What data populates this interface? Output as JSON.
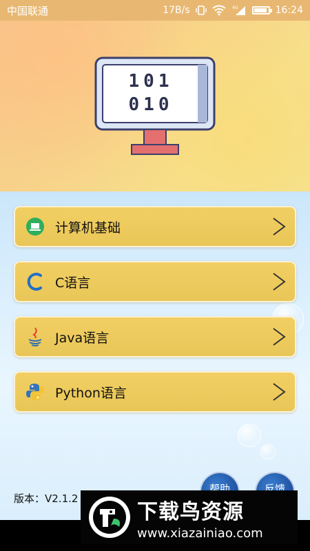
{
  "status_bar": {
    "carrier": "中国联通",
    "speed": "17B/s",
    "network": "4G",
    "time": "16:24"
  },
  "banner": {
    "screen_line1": "101",
    "screen_line2": "010"
  },
  "menu": [
    {
      "label": "计算机基础",
      "icon": "laptop-icon"
    },
    {
      "label": "C语言",
      "icon": "c-letter-icon"
    },
    {
      "label": "Java语言",
      "icon": "java-icon"
    },
    {
      "label": "Python语言",
      "icon": "python-icon"
    }
  ],
  "footer": {
    "version": "版本：V2.1.2",
    "help_button": "帮助",
    "feedback_button": "反馈"
  },
  "watermark": {
    "title": "下载鸟资源",
    "url": "www.xiazainiao.com"
  },
  "colors": {
    "status_bar": "#e8b872",
    "card": "#efcb5e",
    "round_button": "#2a63b8"
  }
}
